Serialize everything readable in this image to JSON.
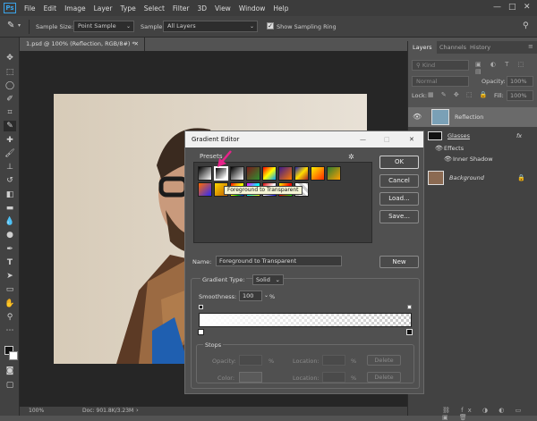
{
  "menu": [
    "File",
    "Edit",
    "Image",
    "Layer",
    "Type",
    "Select",
    "Filter",
    "3D",
    "View",
    "Window",
    "Help"
  ],
  "options": {
    "sample_size_label": "Sample Size:",
    "sample_size_value": "Point Sample",
    "sample_label": "Sample:",
    "sample_value": "All Layers",
    "show_ring_label": "Show Sampling Ring"
  },
  "document": {
    "tab_title": "1.psd @ 100% (Reflection, RGB/8#) *",
    "zoom": "100%",
    "doc_size": "Doc: 901.8K/3.23M"
  },
  "layers_panel": {
    "tabs": [
      "Layers",
      "Channels",
      "History"
    ],
    "kind_placeholder": "Kind",
    "blend_mode": "Normal",
    "opacity_label": "Opacity:",
    "opacity_value": "100%",
    "lock_label": "Lock:",
    "fill_label": "Fill:",
    "fill_value": "100%",
    "layers": [
      {
        "name": "Reflection"
      },
      {
        "name": "Glasses"
      },
      {
        "name": "Effects"
      },
      {
        "name": "Inner Shadow"
      },
      {
        "name": "Background"
      }
    ],
    "fx_label": "fx"
  },
  "gradient_editor": {
    "title": "Gradient Editor",
    "presets_label": "Presets",
    "tooltip": "Foreground to Transparent",
    "buttons": {
      "ok": "OK",
      "cancel": "Cancel",
      "load": "Load...",
      "save": "Save...",
      "new": "New",
      "delete1": "Delete",
      "delete2": "Delete"
    },
    "name_label": "Name:",
    "name_value": "Foreground to Transparent",
    "gradient_type_label": "Gradient Type:",
    "gradient_type_value": "Solid",
    "smoothness_label": "Smoothness:",
    "smoothness_value": "100",
    "percent": "%",
    "stops_label": "Stops",
    "opacity_label": "Opacity:",
    "location_label": "Location:",
    "color_label": "Color:",
    "pct2": "%",
    "pct3": "%",
    "pct4": "%"
  },
  "colors": {
    "accent_arrow": "#e6238a",
    "highlight": "#3ba3e8"
  }
}
